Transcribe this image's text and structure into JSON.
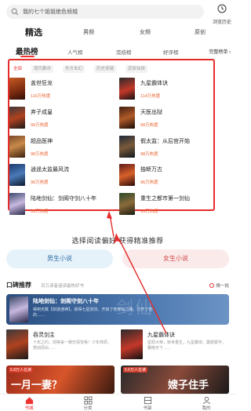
{
  "search": {
    "placeholder": "我的七个姐姐绝色倾城"
  },
  "history": {
    "label": "浏览历史"
  },
  "main_tabs": [
    {
      "label": "精选",
      "active": true
    },
    {
      "label": "男频",
      "active": false
    },
    {
      "label": "女频",
      "active": false
    },
    {
      "label": "原创",
      "active": false
    }
  ],
  "sub_tabs": [
    {
      "label": "最热榜",
      "active": true
    },
    {
      "label": "人气榜",
      "active": false
    },
    {
      "label": "完结榜",
      "active": false
    },
    {
      "label": "好评榜",
      "active": false
    }
  ],
  "sub_more": "完整榜单 ›",
  "chips": [
    {
      "label": "全部",
      "active": true
    },
    {
      "label": "现代都市",
      "active": false
    },
    {
      "label": "东方玄幻",
      "active": false
    },
    {
      "label": "历史穿越",
      "active": false
    },
    {
      "label": "武侠仙侠",
      "active": false
    }
  ],
  "rank_left": [
    {
      "title": "盖世狂龙",
      "heat": "116万热度"
    },
    {
      "title": "弃子成皇",
      "heat": "99万热度"
    },
    {
      "title": "超品医神",
      "heat": "98万热度"
    },
    {
      "title": "逍遥太监最风流",
      "heat": "96万热度"
    },
    {
      "title": "陆地剑仙：剑阁守剑八十年",
      "heat": "95万热度"
    }
  ],
  "rank_right": [
    {
      "title": "九星霸体诀",
      "heat": "114万热度"
    },
    {
      "title": "天医出狱",
      "heat": "99万热度"
    },
    {
      "title": "假太监：从后宫开始",
      "heat": "98万热度"
    },
    {
      "title": "独断万古",
      "heat": "96万热度"
    },
    {
      "title": "重生之都市第一剑仙",
      "heat": "93万热度"
    }
  ],
  "preference": {
    "title": "选择阅读偏好·获得精准推荐",
    "male": "男生小说",
    "female": "女生小说"
  },
  "koubei": {
    "title": "口碑推荐",
    "subtitle": "百万读者追读最热好书",
    "refresh": "换一批",
    "banner": {
      "title": "陆地剑仙：剑阁守剑八十年",
      "desc": "得到天赋【剑道通神】，获得七星剑法，开启了他修仙之路，打开了他的……",
      "watermark": "剑仙"
    },
    "cards": [
      {
        "title": "吞灵剑主",
        "desc": "十年之约，却换来一朝无情背叛！少年林辰，携剑而出……"
      },
      {
        "title": "九星霸体诀",
        "desc": "星辰大帝，转世重生，九星霸体，震撼寰宇，霸绝天下……"
      }
    ],
    "strips": [
      {
        "tag": "5.8万人在读",
        "big": "一月一妻？"
      },
      {
        "tag": "5.6万人在读",
        "big": "嫂子住手"
      }
    ]
  },
  "bottom_nav": [
    {
      "label": "书城",
      "active": true
    },
    {
      "label": "分类",
      "active": false
    },
    {
      "label": "书架",
      "active": false
    },
    {
      "label": "我的",
      "active": false
    }
  ],
  "colors": {
    "accent": "#e33333",
    "annotation": "#e62b2b",
    "heat": "#e8612c"
  }
}
